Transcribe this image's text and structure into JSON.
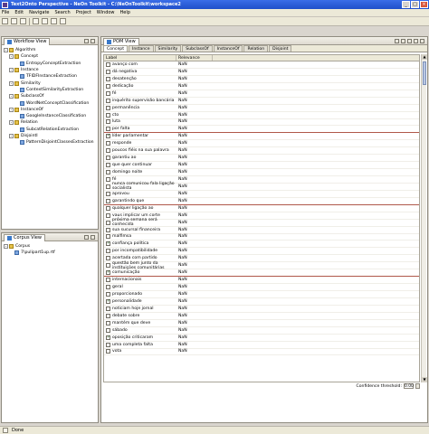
{
  "window": {
    "title": "Text2Onto Perspective - NeOn Toolkit - C:\\NeOnToolkit\\workspace2",
    "minimize": "_",
    "maximize": "□",
    "close": "×"
  },
  "menu": [
    "File",
    "Edit",
    "Navigate",
    "Search",
    "Project",
    "Window",
    "Help"
  ],
  "workflow": {
    "tab": "Workflow View",
    "tree": [
      {
        "label": "Algorithm",
        "level": 0,
        "kind": "folder",
        "exp": "-"
      },
      {
        "label": "Concept",
        "level": 1,
        "kind": "folder",
        "exp": "-"
      },
      {
        "label": "EntropyConceptExtraction",
        "level": 2,
        "kind": "leaf"
      },
      {
        "label": "Instance",
        "level": 1,
        "kind": "folder",
        "exp": "-"
      },
      {
        "label": "TFIDFInstanceExtraction",
        "level": 2,
        "kind": "leaf"
      },
      {
        "label": "Similarity",
        "level": 1,
        "kind": "folder",
        "exp": "-"
      },
      {
        "label": "ContextSimilarityExtraction",
        "level": 2,
        "kind": "leaf"
      },
      {
        "label": "SubclassOf",
        "level": 1,
        "kind": "folder",
        "exp": "-"
      },
      {
        "label": "WordNetConceptClassification",
        "level": 2,
        "kind": "leaf"
      },
      {
        "label": "InstanceOf",
        "level": 1,
        "kind": "folder",
        "exp": "-"
      },
      {
        "label": "GoogleInstanceClassification",
        "level": 2,
        "kind": "leaf"
      },
      {
        "label": "Relation",
        "level": 1,
        "kind": "folder",
        "exp": "-"
      },
      {
        "label": "SubcatRelationExtraction",
        "level": 2,
        "kind": "leaf"
      },
      {
        "label": "DisjointI",
        "level": 1,
        "kind": "folder",
        "exp": "-"
      },
      {
        "label": "PatternDisjointClassesExtraction",
        "level": 2,
        "kind": "leaf"
      }
    ]
  },
  "corpus": {
    "tab": "Corpus View",
    "tree": [
      {
        "label": "Corpus",
        "level": 0,
        "kind": "folder",
        "exp": "-"
      },
      {
        "label": "7\\pulipart1up.rtf",
        "level": 1,
        "kind": "leaf"
      }
    ]
  },
  "pom": {
    "tab": "POM View",
    "subtabs": [
      "Concept",
      "Instance",
      "Similarity",
      "SubclassOf",
      "InstanceOf",
      "Relation",
      "Disjoint"
    ],
    "active_subtab": "Concept",
    "columns": {
      "label": "Label",
      "relevance": "Relevance"
    },
    "rows": [
      {
        "label": "avanço com",
        "rel": "NaN",
        "checked": false
      },
      {
        "label": "dá negativa",
        "rel": "NaN",
        "checked": false
      },
      {
        "label": "desatenção",
        "rel": "NaN",
        "checked": false
      },
      {
        "label": "dedicação",
        "rel": "NaN",
        "checked": false
      },
      {
        "label": "fé",
        "rel": "NaN",
        "checked": false
      },
      {
        "label": "inquérito supervisão bancária",
        "rel": "NaN",
        "checked": false
      },
      {
        "label": "permanência",
        "rel": "NaN",
        "checked": false
      },
      {
        "label": "cto",
        "rel": "NaN",
        "checked": false
      },
      {
        "label": "luta",
        "rel": "NaN",
        "checked": false
      },
      {
        "label": "por falta",
        "rel": "NaN",
        "checked": false,
        "sep": true
      },
      {
        "label": "líder parlamentar",
        "rel": "NaN",
        "checked": true
      },
      {
        "label": "responde",
        "rel": "NaN",
        "checked": false
      },
      {
        "label": "poucos fiéis na sua palavra",
        "rel": "NaN",
        "checked": false
      },
      {
        "label": "garantiu ao",
        "rel": "NaN",
        "checked": false
      },
      {
        "label": "que quer continuar",
        "rel": "NaN",
        "checked": false
      },
      {
        "label": "domingo noite",
        "rel": "NaN",
        "checked": false
      },
      {
        "label": "fé",
        "rel": "NaN",
        "checked": false
      },
      {
        "label": "nunca comunicou fala ligação socialista",
        "rel": "NaN",
        "checked": false
      },
      {
        "label": "aprovou",
        "rel": "NaN",
        "checked": false
      },
      {
        "label": "garantindo que",
        "rel": "NaN",
        "checked": false,
        "sep": true
      },
      {
        "label": "qualquer ligação ao",
        "rel": "NaN",
        "checked": false
      },
      {
        "label": "vaus implicar um corte",
        "rel": "NaN",
        "checked": false
      },
      {
        "label": "próxima semana será conhecida",
        "rel": "NaN",
        "checked": false
      },
      {
        "label": "sua sucursal financeira",
        "rel": "NaN",
        "checked": false
      },
      {
        "label": "malfimsa",
        "rel": "NaN",
        "checked": false
      },
      {
        "label": "confiança política",
        "rel": "NaN",
        "checked": true
      },
      {
        "label": "por incompatibilidade",
        "rel": "NaN",
        "checked": false
      },
      {
        "label": "acertada com partido",
        "rel": "NaN",
        "checked": false
      },
      {
        "label": "questão bem junto da instituições comunitárias",
        "rel": "NaN",
        "checked": false
      },
      {
        "label": "comunicação",
        "rel": "NaN",
        "checked": true,
        "sep": true
      },
      {
        "label": "internacionais",
        "rel": "NaN",
        "checked": false
      },
      {
        "label": "geral",
        "rel": "NaN",
        "checked": false
      },
      {
        "label": "proporcionado",
        "rel": "NaN",
        "checked": false
      },
      {
        "label": "personalidade",
        "rel": "NaN",
        "checked": true
      },
      {
        "label": "noticiam hoje jornal",
        "rel": "NaN",
        "checked": false
      },
      {
        "label": "debate sobre",
        "rel": "NaN",
        "checked": false
      },
      {
        "label": "mantém que deve",
        "rel": "NaN",
        "checked": false
      },
      {
        "label": "sábado",
        "rel": "NaN",
        "checked": false
      },
      {
        "label": "oposição criticaram",
        "rel": "NaN",
        "checked": true
      },
      {
        "label": "uma completa falta",
        "rel": "NaN",
        "checked": false
      },
      {
        "label": "vota",
        "rel": "NaN",
        "checked": false
      }
    ],
    "confidence_label": "Confidence threshold:",
    "confidence_value": "0.00"
  },
  "status": {
    "text": "Done"
  }
}
